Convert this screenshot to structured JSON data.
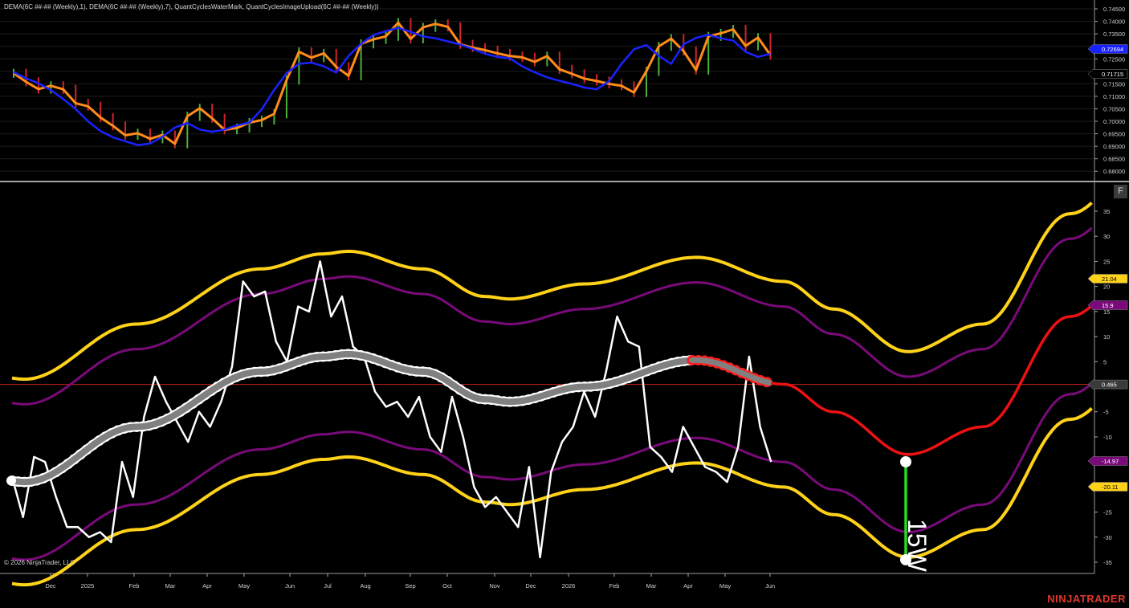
{
  "header": {
    "indicator_line": "DEMA(6C ##-## (Weekly),1), DEMA(6C ##-## (Weekly),7), QuantCyclesWaterMark, QuantCyclesImageUpload(6C ##-## (Weekly))"
  },
  "footer": {
    "copyright": "© 2026 NinjaTrader, LLC",
    "brand": "NINJATRADER",
    "panel_button": "F"
  },
  "colors": {
    "background": "#000000",
    "price_line": "#ff8c1a",
    "dema_line": "#1a22ff",
    "up_bar": "#4caf3a",
    "down_bar": "#d0242a",
    "outer_band": "#ffd21a",
    "inner_band": "#7a0a7a",
    "midline": "#808080",
    "projection": "#ee1111",
    "oscillator": "#ffffff",
    "zero_line": "#c8201e",
    "marker_green": "#22dd22"
  },
  "chart_data": [
    {
      "type": "line",
      "name": "price_panel",
      "yticks": [
        "0.74500",
        "0.74000",
        "0.73500",
        "0.73000",
        "0.72500",
        "0.72000",
        "0.71500",
        "0.71000",
        "0.70500",
        "0.70000",
        "0.69500",
        "0.69000",
        "0.68500",
        "0.68000"
      ],
      "ylim": [
        0.6775,
        0.7463
      ],
      "weeks": [
        0,
        62
      ],
      "series": [
        {
          "name": "price",
          "values": [
            0.7192,
            0.7158,
            0.7129,
            0.7142,
            0.7128,
            0.7072,
            0.706,
            0.7015,
            0.6982,
            0.6944,
            0.6952,
            0.693,
            0.6945,
            0.691,
            0.702,
            0.7052,
            0.7012,
            0.6966,
            0.6973,
            0.6995,
            0.7005,
            0.703,
            0.7165,
            0.7278,
            0.7255,
            0.7272,
            0.7218,
            0.7182,
            0.731,
            0.7328,
            0.734,
            0.7395,
            0.733,
            0.7376,
            0.739,
            0.7378,
            0.7308,
            0.7295,
            0.7285,
            0.7272,
            0.7261,
            0.7256,
            0.7238,
            0.7261,
            0.7208,
            0.719,
            0.7171,
            0.7161,
            0.715,
            0.7142,
            0.7115,
            0.72,
            0.73,
            0.7331,
            0.7281,
            0.7205,
            0.734,
            0.7352,
            0.7368,
            0.7302,
            0.7335,
            0.7265
          ]
        },
        {
          "name": "dema",
          "values": [
            0.7197,
            0.7172,
            0.7152,
            0.7125,
            0.7089,
            0.7049,
            0.7,
            0.6961,
            0.6936,
            0.692,
            0.6905,
            0.6911,
            0.6938,
            0.6975,
            0.6993,
            0.6967,
            0.6958,
            0.6967,
            0.6984,
            0.6995,
            0.7048,
            0.7125,
            0.7193,
            0.723,
            0.7235,
            0.722,
            0.7195,
            0.7262,
            0.731,
            0.7345,
            0.7361,
            0.7374,
            0.7358,
            0.734,
            0.7332,
            0.732,
            0.7307,
            0.729,
            0.727,
            0.7258,
            0.7252,
            0.722,
            0.7196,
            0.7176,
            0.7162,
            0.715,
            0.7135,
            0.7128,
            0.716,
            0.723,
            0.7288,
            0.7305,
            0.7262,
            0.723,
            0.7308,
            0.7334,
            0.7346,
            0.7332,
            0.7323,
            0.7278,
            0.7258,
            0.727
          ]
        }
      ],
      "price_labels": [
        "0.72694",
        "0.71715"
      ],
      "xlabels": [
        "Dec",
        "2025",
        "Feb",
        "Mar",
        "Apr",
        "May",
        "Jun",
        "Jul",
        "Aug",
        "Sep",
        "Oct",
        "Nov",
        "Dec",
        "2026",
        "Feb",
        "Mar",
        "Apr",
        "May",
        "Jun"
      ]
    },
    {
      "type": "line",
      "name": "cycle_panel",
      "yticks": [
        "35",
        "30",
        "25",
        "20",
        "15",
        "10",
        "5",
        "0",
        "-5",
        "-10",
        "-15",
        "-20",
        "-25",
        "-30",
        "-35"
      ],
      "ylim": [
        -37.5,
        38.5
      ],
      "price_labels": [
        "21.04",
        "15.9",
        "0.465",
        "-14.97",
        "-20.11"
      ],
      "annotation": "15W",
      "marker_top": -14.97,
      "marker_bottom": -34.5,
      "series": [
        {
          "name": "oscillator",
          "values": [
            -18,
            -26,
            -14,
            -15,
            -22,
            -28,
            -28,
            -30,
            -29,
            -31,
            -15,
            -22,
            -6,
            2,
            -3,
            -7,
            -11,
            -5,
            -8,
            -3,
            4,
            21,
            18,
            19,
            9,
            5,
            16,
            15,
            25,
            14,
            18,
            8,
            6,
            -1,
            -4,
            -3,
            -6,
            -2,
            -10,
            -13,
            -2,
            -10,
            -20,
            -24,
            -22,
            -25,
            -28,
            -16,
            -34,
            -17,
            -11,
            -8,
            -1,
            -6,
            3,
            14,
            9,
            8,
            -12,
            -14,
            -17,
            -8,
            -12,
            -16,
            -17,
            -19,
            -12,
            6,
            -8,
            -15
          ]
        }
      ]
    }
  ]
}
